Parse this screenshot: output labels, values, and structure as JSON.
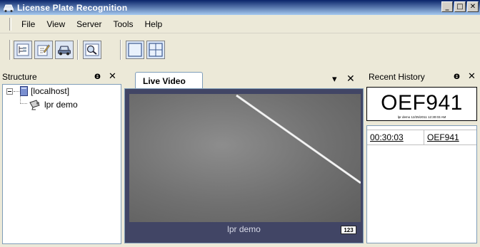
{
  "window": {
    "title": "License Plate Recognition",
    "buttons": {
      "minimize": "_",
      "maximize": "□",
      "close": "✕"
    }
  },
  "menu": {
    "items": [
      "File",
      "View",
      "Server",
      "Tools",
      "Help"
    ]
  },
  "toolbar": {
    "icons": [
      "structure-tree-icon",
      "edit-icon",
      "car-icon",
      "search-vehicle-icon",
      "single-view-layout-icon",
      "quad-view-layout-icon"
    ]
  },
  "structure_panel": {
    "title": "Structure",
    "pin": "ɵ",
    "close": "✕",
    "tree": {
      "root": "[localhost]",
      "child": "lpr demo"
    }
  },
  "video_panel": {
    "tab_label": "Live Video",
    "dropdown": "▾",
    "close": "✕",
    "camera_name": "lpr demo",
    "badge": "123"
  },
  "history_panel": {
    "title": "Recent History",
    "pin": "ɵ",
    "close": "✕",
    "current_plate": "OEF941",
    "current_meta": "lpr demo   12/25/2011 12:30:03 AM",
    "entries": [
      {
        "time": "00:30:03",
        "plate": "OEF941"
      }
    ]
  },
  "colors": {
    "titlebar_start": "#0a246a",
    "titlebar_end": "#a6caf0",
    "panel_bg": "#ece9d8",
    "video_frame": "#414565",
    "border": "#7f9db9"
  }
}
